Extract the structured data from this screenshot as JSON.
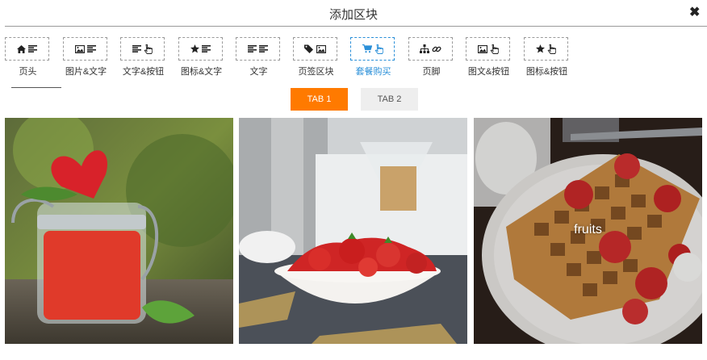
{
  "dialog": {
    "title": "添加区块",
    "close_symbol": "✖"
  },
  "blocks": [
    {
      "label": "页头",
      "icons": [
        "home-icon",
        "align-left-icon"
      ],
      "active": false
    },
    {
      "label": "图片&文字",
      "icons": [
        "image-icon",
        "align-left-icon"
      ],
      "active": false
    },
    {
      "label": "文字&按钮",
      "icons": [
        "align-left-icon",
        "hand-pointer-icon"
      ],
      "active": false
    },
    {
      "label": "图标&文字",
      "icons": [
        "star-icon",
        "align-left-icon"
      ],
      "active": false
    },
    {
      "label": "文字",
      "icons": [
        "align-left-icon",
        "align-left-icon"
      ],
      "active": false
    },
    {
      "label": "页签区块",
      "icons": [
        "tags-icon",
        "image-icon"
      ],
      "active": false
    },
    {
      "label": "套餐购买",
      "icons": [
        "cart-icon",
        "hand-pointer-icon"
      ],
      "active": true
    },
    {
      "label": "页脚",
      "icons": [
        "sitemap-icon",
        "link-icon"
      ],
      "active": false
    },
    {
      "label": "图文&按钮",
      "icons": [
        "image-icon",
        "hand-pointer-icon"
      ],
      "active": false
    },
    {
      "label": "图标&按钮",
      "icons": [
        "star-icon",
        "hand-pointer-icon"
      ],
      "active": false
    }
  ],
  "tabs": {
    "tab1": "TAB 1",
    "tab2": "TAB 2",
    "active": "tab1"
  },
  "photos": [
    {
      "caption": "",
      "subject": "heart-jar"
    },
    {
      "caption": "",
      "subject": "strawberry-bowl"
    },
    {
      "caption": "fruits",
      "subject": "waffle-strawberries"
    }
  ],
  "colors": {
    "accent": "#ff7a00",
    "active_block": "#2a8fd8",
    "inactive_tab": "#eeeeee"
  }
}
